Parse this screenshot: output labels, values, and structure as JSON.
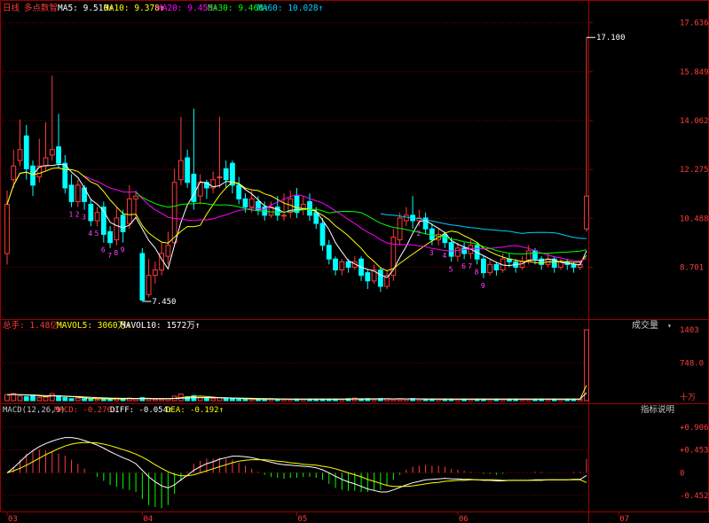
{
  "colors": {
    "bg": "#000000",
    "up": "#ff3b3b",
    "down": "#00ffff",
    "grid": "#7a0000",
    "frame": "#9b0000",
    "axis_text": "#ff3b3b",
    "ma5": "#ffffff",
    "ma10": "#ffff00",
    "ma20": "#ff00ff",
    "ma30": "#00ff00",
    "ma60": "#00ccff",
    "volma5": "#ffff00",
    "volma10": "#ffffff",
    "diff": "#ffffff",
    "dea": "#ffff00",
    "td_label": "#ff44ff"
  },
  "header": {
    "period": "日线",
    "indicator": "多点数智",
    "ma5": "MA5: 9.510↑",
    "ma10": "MA10: 9.378↑",
    "ma20": "MA20: 9.455↑",
    "ma30": "MA30: 9.468↑",
    "ma60": "MA60: 10.028↑"
  },
  "volume_header": {
    "total": "总手: 1.48亿↑",
    "mavol5": "MAVOL5: 3060万↑",
    "mavol10": "MAVOL10: 1572万↑",
    "title": "成交量",
    "title_arrow": "▾"
  },
  "macd_header": {
    "params": "MACD(12,26,9)",
    "macd": "MACD: -0.276↑",
    "diff": "DIFF: -0.054↑",
    "dea": "DEA: -0.192↑",
    "help": "指标说明"
  },
  "chart_data": [
    {
      "type": "candlestick",
      "name": "price",
      "y_ticks": [
        "17.636",
        "15.849",
        "14.062",
        "12.275",
        "10.488",
        "8.701"
      ],
      "ylim": [
        6.9,
        17.95
      ],
      "annotations": [
        {
          "text": "17.100",
          "type": "high"
        },
        {
          "text": "7.450",
          "type": "low"
        }
      ],
      "td_labels": [
        "1",
        "2",
        "3",
        "4",
        "5",
        "6",
        "7",
        "8",
        "9",
        "2",
        "3",
        "4",
        "5",
        "6",
        "7",
        "8",
        "9"
      ],
      "candles": [
        {
          "o": 9.2,
          "c": 11.0,
          "h": 11.5,
          "l": 8.8
        },
        {
          "o": 11.9,
          "c": 12.4,
          "h": 13.0,
          "l": 11.6
        },
        {
          "o": 12.6,
          "c": 13.0,
          "h": 14.1,
          "l": 12.4
        },
        {
          "o": 13.5,
          "c": 12.3,
          "h": 13.9,
          "l": 11.9
        },
        {
          "o": 12.4,
          "c": 11.7,
          "h": 12.6,
          "l": 11.3
        },
        {
          "o": 12.0,
          "c": 12.4,
          "h": 13.4,
          "l": 11.8
        },
        {
          "o": 12.4,
          "c": 12.7,
          "h": 14.0,
          "l": 12.2
        },
        {
          "o": 12.8,
          "c": 13.0,
          "h": 15.7,
          "l": 12.6
        },
        {
          "o": 13.1,
          "c": 12.5,
          "h": 14.3,
          "l": 12.3
        },
        {
          "o": 12.5,
          "c": 11.6,
          "h": 12.8,
          "l": 11.4
        },
        {
          "o": 11.7,
          "c": 11.1,
          "h": 12.1,
          "l": 10.9
        },
        {
          "o": 11.1,
          "c": 11.7,
          "h": 11.9,
          "l": 10.9
        },
        {
          "o": 11.6,
          "c": 11.1,
          "h": 11.7,
          "l": 10.8
        },
        {
          "o": 11.0,
          "c": 10.4,
          "h": 11.2,
          "l": 10.2
        },
        {
          "o": 10.4,
          "c": 10.7,
          "h": 10.9,
          "l": 10.2
        },
        {
          "o": 10.9,
          "c": 9.9,
          "h": 11.1,
          "l": 9.6
        },
        {
          "o": 10.0,
          "c": 9.6,
          "h": 10.2,
          "l": 9.4
        },
        {
          "o": 9.7,
          "c": 10.5,
          "h": 10.9,
          "l": 9.5
        },
        {
          "o": 10.6,
          "c": 10.0,
          "h": 10.8,
          "l": 9.6
        },
        {
          "o": 10.3,
          "c": 11.2,
          "h": 11.7,
          "l": 10.1
        },
        {
          "o": 11.2,
          "c": 11.3,
          "h": 11.5,
          "l": 10.5
        },
        {
          "o": 9.2,
          "c": 7.5,
          "h": 9.4,
          "l": 7.45
        },
        {
          "o": 7.7,
          "c": 8.4,
          "h": 9.0,
          "l": 7.6
        },
        {
          "o": 8.4,
          "c": 8.6,
          "h": 8.9,
          "l": 8.1
        },
        {
          "o": 8.6,
          "c": 9.2,
          "h": 9.6,
          "l": 8.4
        },
        {
          "o": 9.1,
          "c": 9.5,
          "h": 10.0,
          "l": 8.8
        },
        {
          "o": 9.6,
          "c": 11.8,
          "h": 12.3,
          "l": 9.5
        },
        {
          "o": 11.9,
          "c": 12.6,
          "h": 14.2,
          "l": 11.7
        },
        {
          "o": 12.7,
          "c": 11.8,
          "h": 13.0,
          "l": 11.6
        },
        {
          "o": 12.1,
          "c": 11.1,
          "h": 14.5,
          "l": 10.8
        },
        {
          "o": 11.3,
          "c": 11.8,
          "h": 12.1,
          "l": 11.0
        },
        {
          "o": 11.8,
          "c": 11.6,
          "h": 11.9,
          "l": 11.2
        },
        {
          "o": 11.6,
          "c": 11.9,
          "h": 12.2,
          "l": 11.4
        },
        {
          "o": 12.0,
          "c": 12.0,
          "h": 14.2,
          "l": 11.6
        },
        {
          "o": 12.3,
          "c": 11.9,
          "h": 12.6,
          "l": 11.6
        },
        {
          "o": 12.5,
          "c": 11.7,
          "h": 12.6,
          "l": 11.4
        },
        {
          "o": 11.7,
          "c": 11.2,
          "h": 12.0,
          "l": 11.0
        },
        {
          "o": 11.2,
          "c": 10.9,
          "h": 11.4,
          "l": 10.7
        },
        {
          "o": 10.9,
          "c": 11.2,
          "h": 11.5,
          "l": 10.7
        },
        {
          "o": 11.1,
          "c": 10.8,
          "h": 11.3,
          "l": 10.6
        },
        {
          "o": 10.9,
          "c": 10.6,
          "h": 11.1,
          "l": 10.4
        },
        {
          "o": 10.6,
          "c": 10.9,
          "h": 11.1,
          "l": 10.5
        },
        {
          "o": 10.9,
          "c": 10.6,
          "h": 11.3,
          "l": 10.4
        },
        {
          "o": 10.6,
          "c": 10.6,
          "h": 11.4,
          "l": 10.4
        },
        {
          "o": 10.7,
          "c": 11.2,
          "h": 11.5,
          "l": 10.5
        },
        {
          "o": 11.3,
          "c": 10.7,
          "h": 11.6,
          "l": 10.5
        },
        {
          "o": 10.8,
          "c": 11.0,
          "h": 11.3,
          "l": 10.6
        },
        {
          "o": 11.1,
          "c": 10.6,
          "h": 11.4,
          "l": 10.4
        },
        {
          "o": 10.7,
          "c": 10.3,
          "h": 10.9,
          "l": 10.1
        },
        {
          "o": 10.3,
          "c": 9.5,
          "h": 10.5,
          "l": 9.3
        },
        {
          "o": 9.5,
          "c": 9.0,
          "h": 9.7,
          "l": 8.8
        },
        {
          "o": 9.0,
          "c": 8.6,
          "h": 9.1,
          "l": 8.4
        },
        {
          "o": 8.6,
          "c": 8.9,
          "h": 9.0,
          "l": 8.4
        },
        {
          "o": 8.9,
          "c": 8.7,
          "h": 9.0,
          "l": 8.5
        },
        {
          "o": 8.7,
          "c": 8.9,
          "h": 9.1,
          "l": 8.6
        },
        {
          "o": 9.0,
          "c": 8.4,
          "h": 9.1,
          "l": 8.2
        },
        {
          "o": 8.5,
          "c": 8.2,
          "h": 8.6,
          "l": 7.9
        },
        {
          "o": 8.2,
          "c": 8.6,
          "h": 8.8,
          "l": 8.1
        },
        {
          "o": 8.6,
          "c": 8.0,
          "h": 8.7,
          "l": 7.8
        },
        {
          "o": 8.0,
          "c": 8.4,
          "h": 8.6,
          "l": 7.9
        },
        {
          "o": 8.4,
          "c": 9.8,
          "h": 10.1,
          "l": 8.2
        },
        {
          "o": 9.7,
          "c": 10.5,
          "h": 10.7,
          "l": 9.5
        },
        {
          "o": 10.4,
          "c": 10.6,
          "h": 10.9,
          "l": 10.2
        },
        {
          "o": 10.6,
          "c": 10.4,
          "h": 11.3,
          "l": 10.1
        },
        {
          "o": 10.4,
          "c": 10.5,
          "h": 10.8,
          "l": 10.2
        },
        {
          "o": 10.5,
          "c": 10.1,
          "h": 10.7,
          "l": 9.9
        },
        {
          "o": 10.1,
          "c": 9.7,
          "h": 10.3,
          "l": 9.5
        },
        {
          "o": 9.7,
          "c": 9.9,
          "h": 10.1,
          "l": 9.5
        },
        {
          "o": 9.9,
          "c": 9.6,
          "h": 10.0,
          "l": 9.4
        },
        {
          "o": 9.6,
          "c": 9.1,
          "h": 9.8,
          "l": 8.9
        },
        {
          "o": 9.1,
          "c": 9.4,
          "h": 9.6,
          "l": 8.9
        },
        {
          "o": 9.4,
          "c": 9.2,
          "h": 9.6,
          "l": 9.0
        },
        {
          "o": 9.2,
          "c": 9.5,
          "h": 9.7,
          "l": 9.0
        },
        {
          "o": 9.5,
          "c": 9.0,
          "h": 9.6,
          "l": 8.8
        },
        {
          "o": 9.0,
          "c": 8.5,
          "h": 9.1,
          "l": 8.3
        },
        {
          "o": 8.5,
          "c": 8.8,
          "h": 9.0,
          "l": 8.4
        },
        {
          "o": 8.8,
          "c": 8.6,
          "h": 8.9,
          "l": 8.4
        },
        {
          "o": 8.6,
          "c": 9.0,
          "h": 9.2,
          "l": 8.5
        },
        {
          "o": 9.0,
          "c": 8.9,
          "h": 9.2,
          "l": 8.7
        },
        {
          "o": 8.9,
          "c": 8.7,
          "h": 9.0,
          "l": 8.5
        },
        {
          "o": 8.7,
          "c": 8.9,
          "h": 9.1,
          "l": 8.6
        },
        {
          "o": 8.9,
          "c": 9.3,
          "h": 9.5,
          "l": 8.8
        },
        {
          "o": 9.3,
          "c": 9.0,
          "h": 9.4,
          "l": 8.8
        },
        {
          "o": 9.0,
          "c": 8.8,
          "h": 9.1,
          "l": 8.6
        },
        {
          "o": 8.8,
          "c": 9.0,
          "h": 9.2,
          "l": 8.7
        },
        {
          "o": 9.0,
          "c": 8.7,
          "h": 9.1,
          "l": 8.5
        },
        {
          "o": 8.7,
          "c": 8.9,
          "h": 9.0,
          "l": 8.6
        },
        {
          "o": 8.9,
          "c": 8.8,
          "h": 9.0,
          "l": 8.6
        },
        {
          "o": 8.8,
          "c": 8.7,
          "h": 8.9,
          "l": 8.5
        },
        {
          "o": 8.7,
          "c": 8.8,
          "h": 8.9,
          "l": 8.6
        },
        {
          "o": 10.1,
          "c": 11.3,
          "h": 17.1,
          "l": 10.0
        }
      ]
    },
    {
      "type": "bar",
      "name": "volume",
      "y_ticks": [
        "1403",
        "748.0",
        "十万"
      ],
      "ylim": [
        0,
        1403
      ],
      "values": [
        120,
        140,
        90,
        80,
        110,
        60,
        70,
        140,
        90,
        60,
        40,
        50,
        40,
        30,
        30,
        40,
        30,
        40,
        30,
        50,
        40,
        60,
        40,
        30,
        30,
        40,
        90,
        130,
        80,
        100,
        60,
        50,
        40,
        60,
        50,
        40,
        30,
        30,
        30,
        30,
        30,
        30,
        30,
        30,
        30,
        30,
        30,
        30,
        30,
        30,
        30,
        30,
        30,
        40,
        50,
        30,
        40,
        30,
        40,
        40,
        30,
        40,
        30,
        40,
        30,
        30,
        30,
        30,
        30,
        30,
        30,
        30,
        30,
        30,
        30,
        30,
        30,
        30,
        30,
        30,
        30,
        30,
        30,
        30,
        30,
        30,
        30,
        30,
        30,
        30,
        1403
      ],
      "ma5": [
        120,
        125,
        120,
        110,
        110,
        95,
        80,
        95,
        95,
        85,
        80,
        70,
        55,
        45,
        40,
        40,
        35,
        35,
        35,
        40,
        40,
        45,
        45,
        40,
        40,
        40,
        45,
        60,
        70,
        80,
        90,
        80,
        70,
        60,
        55,
        50,
        45,
        40,
        35,
        32,
        30,
        30,
        30,
        30,
        30,
        30,
        30,
        30,
        30,
        30,
        30,
        30,
        32,
        34,
        36,
        36,
        37,
        36,
        37,
        36,
        35,
        36,
        35,
        36,
        35,
        34,
        32,
        31,
        30,
        30,
        30,
        30,
        30,
        30,
        30,
        30,
        30,
        30,
        30,
        30,
        30,
        30,
        30,
        30,
        30,
        30,
        30,
        30,
        30,
        30,
        306
      ],
      "ma10": [
        120,
        122,
        120,
        115,
        112,
        105,
        98,
        98,
        96,
        90,
        85,
        80,
        72,
        65,
        60,
        55,
        50,
        48,
        45,
        45,
        42,
        42,
        40,
        38,
        38,
        40,
        42,
        48,
        52,
        56,
        60,
        62,
        60,
        58,
        56,
        52,
        50,
        48,
        45,
        42,
        40,
        38,
        35,
        33,
        32,
        30,
        30,
        30,
        30,
        30,
        30,
        30,
        31,
        32,
        33,
        34,
        34,
        34,
        35,
        35,
        35,
        35,
        35,
        35,
        35,
        34,
        34,
        33,
        33,
        32,
        32,
        31,
        31,
        30,
        30,
        30,
        30,
        30,
        30,
        30,
        30,
        30,
        30,
        30,
        30,
        30,
        30,
        30,
        30,
        30,
        157
      ]
    },
    {
      "type": "macd",
      "name": "macd",
      "y_ticks": [
        "+0.906",
        "+0.453",
        "0",
        "-0.452"
      ],
      "ylim": [
        -0.75,
        1.15
      ],
      "diff": [
        0.0,
        0.1,
        0.22,
        0.34,
        0.44,
        0.52,
        0.58,
        0.63,
        0.67,
        0.7,
        0.7,
        0.68,
        0.64,
        0.6,
        0.55,
        0.49,
        0.42,
        0.36,
        0.3,
        0.25,
        0.18,
        0.05,
        -0.08,
        -0.18,
        -0.26,
        -0.3,
        -0.24,
        -0.14,
        -0.05,
        0.05,
        0.12,
        0.18,
        0.22,
        0.27,
        0.3,
        0.33,
        0.33,
        0.32,
        0.3,
        0.27,
        0.24,
        0.21,
        0.18,
        0.16,
        0.15,
        0.14,
        0.13,
        0.12,
        0.1,
        0.06,
        0.0,
        -0.07,
        -0.13,
        -0.18,
        -0.22,
        -0.27,
        -0.32,
        -0.35,
        -0.38,
        -0.38,
        -0.34,
        -0.29,
        -0.24,
        -0.2,
        -0.17,
        -0.14,
        -0.13,
        -0.12,
        -0.11,
        -0.12,
        -0.12,
        -0.13,
        -0.13,
        -0.14,
        -0.15,
        -0.15,
        -0.16,
        -0.16,
        -0.15,
        -0.15,
        -0.15,
        -0.15,
        -0.14,
        -0.14,
        -0.14,
        -0.14,
        -0.14,
        -0.14,
        -0.13,
        -0.13,
        -0.054
      ],
      "dea": [
        0.0,
        0.04,
        0.09,
        0.15,
        0.22,
        0.29,
        0.36,
        0.42,
        0.48,
        0.53,
        0.57,
        0.59,
        0.6,
        0.6,
        0.59,
        0.57,
        0.54,
        0.5,
        0.46,
        0.42,
        0.37,
        0.31,
        0.24,
        0.16,
        0.09,
        0.02,
        -0.03,
        -0.06,
        -0.06,
        -0.04,
        0.0,
        0.04,
        0.08,
        0.12,
        0.16,
        0.2,
        0.23,
        0.25,
        0.26,
        0.26,
        0.26,
        0.25,
        0.23,
        0.22,
        0.2,
        0.19,
        0.17,
        0.16,
        0.15,
        0.13,
        0.11,
        0.08,
        0.04,
        0.0,
        -0.04,
        -0.08,
        -0.13,
        -0.17,
        -0.21,
        -0.25,
        -0.27,
        -0.27,
        -0.27,
        -0.26,
        -0.24,
        -0.22,
        -0.2,
        -0.19,
        -0.17,
        -0.16,
        -0.15,
        -0.15,
        -0.14,
        -0.14,
        -0.14,
        -0.14,
        -0.14,
        -0.15,
        -0.15,
        -0.15,
        -0.15,
        -0.15,
        -0.15,
        -0.15,
        -0.14,
        -0.14,
        -0.14,
        -0.14,
        -0.14,
        -0.14,
        -0.192
      ]
    }
  ],
  "x_axis": {
    "ticks": [
      {
        "index": 0,
        "label": "03"
      },
      {
        "index": 21,
        "label": "04"
      },
      {
        "index": 45,
        "label": "05"
      },
      {
        "index": 70,
        "label": "06"
      },
      {
        "index": 95,
        "label": "07"
      }
    ]
  }
}
